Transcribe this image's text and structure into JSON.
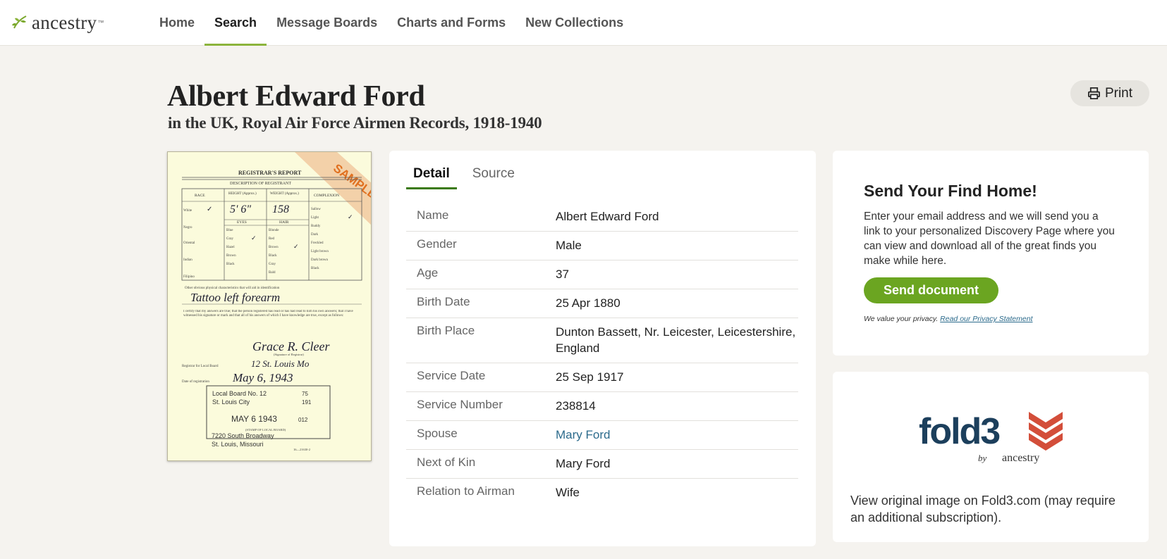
{
  "header": {
    "brand": "ancestry",
    "nav": [
      {
        "label": "Home",
        "active": false
      },
      {
        "label": "Search",
        "active": true
      },
      {
        "label": "Message Boards",
        "active": false
      },
      {
        "label": "Charts and Forms",
        "active": false
      },
      {
        "label": "New Collections",
        "active": false
      }
    ]
  },
  "record": {
    "name": "Albert Edward Ford",
    "collection": "in the UK, Royal Air Force Airmen Records, 1918-1940",
    "print_label": "Print"
  },
  "sample_image": {
    "badge": "SAMPLE",
    "heading": "REGISTRAR'S REPORT",
    "subheading": "DESCRIPTION OF REGISTRANT",
    "columns": [
      "RACE",
      "HEIGHT (Approx.)",
      "WEIGHT (Approx.)",
      "COMPLEXION"
    ],
    "race_options": [
      "White",
      "Negro",
      "Oriental",
      "Indian",
      "Filipino"
    ],
    "eyes_label": "EYES",
    "hair_label": "HAIR",
    "eyes_options": [
      "Blue",
      "Gray",
      "Hazel",
      "Brown",
      "Black"
    ],
    "hair_options": [
      "Blonde",
      "Red",
      "Brown",
      "Black",
      "Gray",
      "Bald"
    ],
    "complexion_options": [
      "Sallow",
      "Light",
      "Ruddy",
      "Dark",
      "Freckled",
      "Light brown",
      "Dark brown",
      "Black"
    ],
    "height_value": "5' 6\"",
    "weight_value": "158",
    "marks_note": "Other obvious physical characteristics that will aid in identification",
    "marks_value": "Tattoo left forearm",
    "certify_text": "I certify that my answers are true; that the person registered has read or has had read to him his own answers; that I have witnessed his signature or mark and that all of his answers of which I have knowledge are true, except as follows:",
    "signature": "Grace R. Cleer",
    "signature_caption": "(Signature of Registrar)",
    "registrar_label": "Registrar for Local Board",
    "registrar_value": "12  St. Louis  Mo",
    "date_label": "Date of registration",
    "date_value": "May 6, 1943",
    "stamp_board": "Local Board No. 12",
    "stamp_number": "75",
    "stamp_city": "St. Louis City",
    "stamp_code": "191",
    "stamp_date": "MAY 6  1943",
    "stamp_extra": "012",
    "stamp_caption": "(STAMP OF LOCAL BOARD)",
    "address_1": "7220 South Broadway",
    "address_2": "St. Louis, Missouri",
    "form_number": "16—21630-2"
  },
  "detail": {
    "tabs": [
      {
        "label": "Detail",
        "active": true
      },
      {
        "label": "Source",
        "active": false
      }
    ],
    "rows": [
      {
        "label": "Name",
        "value": "Albert Edward Ford"
      },
      {
        "label": "Gender",
        "value": "Male"
      },
      {
        "label": "Age",
        "value": "37"
      },
      {
        "label": "Birth Date",
        "value": "25 Apr 1880"
      },
      {
        "label": "Birth Place",
        "value": "Dunton Bassett, Nr. Leicester, Leicestershire, England"
      },
      {
        "label": "Service Date",
        "value": "25 Sep 1917"
      },
      {
        "label": "Service Number",
        "value": "238814"
      },
      {
        "label": "Spouse",
        "value": "Mary Ford",
        "link": true
      },
      {
        "label": "Next of Kin",
        "value": "Mary Ford"
      },
      {
        "label": "Relation to Airman",
        "value": "Wife"
      }
    ]
  },
  "send_home": {
    "title": "Send Your Find Home!",
    "body": "Enter your email address and we will send you a link to your personalized Discovery Page where you can view and download all of the great finds you make while here.",
    "button": "Send document",
    "privacy_text": "We value your privacy.",
    "privacy_link": "Read our Privacy Statement"
  },
  "fold3": {
    "logo_text": "fold3",
    "byline_by": "by",
    "byline_brand": "ancestry",
    "text": "View original image on Fold3.com (may require an additional subscription)."
  },
  "colors": {
    "accent_green": "#8cb43c",
    "button_green": "#6ba521",
    "link_blue": "#2c6b8c",
    "fold3_navy": "#1c3f5c",
    "fold3_red": "#d34e3a"
  }
}
